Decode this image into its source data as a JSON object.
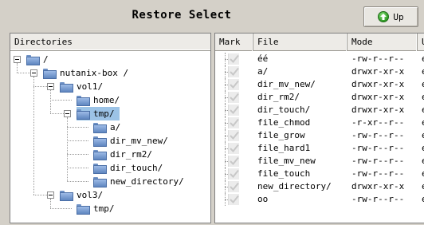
{
  "window": {
    "title": "Restore Select",
    "up_button": "Up",
    "up_icon": "arrow-up-circle-icon"
  },
  "directories": {
    "header": "Directories",
    "nodes": [
      {
        "label": "/",
        "depth": 0,
        "expander": true
      },
      {
        "label": "nutanix-box /",
        "depth": 1,
        "expander": true
      },
      {
        "label": "vol1/",
        "depth": 2,
        "expander": true
      },
      {
        "label": "home/",
        "depth": 3,
        "expander": false
      },
      {
        "label": "tmp/",
        "depth": 3,
        "expander": true,
        "selected": true
      },
      {
        "label": "a/",
        "depth": 4,
        "expander": false
      },
      {
        "label": "dir_mv_new/",
        "depth": 4,
        "expander": false
      },
      {
        "label": "dir_rm2/",
        "depth": 4,
        "expander": false
      },
      {
        "label": "dir_touch/",
        "depth": 4,
        "expander": false
      },
      {
        "label": "new_directory/",
        "depth": 4,
        "expander": false
      },
      {
        "label": "vol3/",
        "depth": 2,
        "expander": true
      },
      {
        "label": "tmp/",
        "depth": 3,
        "expander": false
      }
    ]
  },
  "files": {
    "headers": {
      "mark": "Mark",
      "file": "File",
      "mode": "Mode",
      "user": "U"
    },
    "rows": [
      {
        "file": "éé",
        "mode": "-rw-r--r--",
        "user": "e"
      },
      {
        "file": "a/",
        "mode": "drwxr-xr-x",
        "user": "e"
      },
      {
        "file": "dir_mv_new/",
        "mode": "drwxr-xr-x",
        "user": "e"
      },
      {
        "file": "dir_rm2/",
        "mode": "drwxr-xr-x",
        "user": "e"
      },
      {
        "file": "dir_touch/",
        "mode": "drwxr-xr-x",
        "user": "e"
      },
      {
        "file": "file_chmod",
        "mode": "-r-xr--r--",
        "user": "e"
      },
      {
        "file": "file_grow",
        "mode": "-rw-r--r--",
        "user": "e"
      },
      {
        "file": "file_hard1",
        "mode": "-rw-r--r--",
        "user": "e"
      },
      {
        "file": "file_mv_new",
        "mode": "-rw-r--r--",
        "user": "e"
      },
      {
        "file": "file_touch",
        "mode": "-rw-r--r--",
        "user": "e"
      },
      {
        "file": "new_directory/",
        "mode": "drwxr-xr-x",
        "user": "e"
      },
      {
        "file": "oo",
        "mode": "-rw-r--r--",
        "user": "e"
      }
    ]
  }
}
